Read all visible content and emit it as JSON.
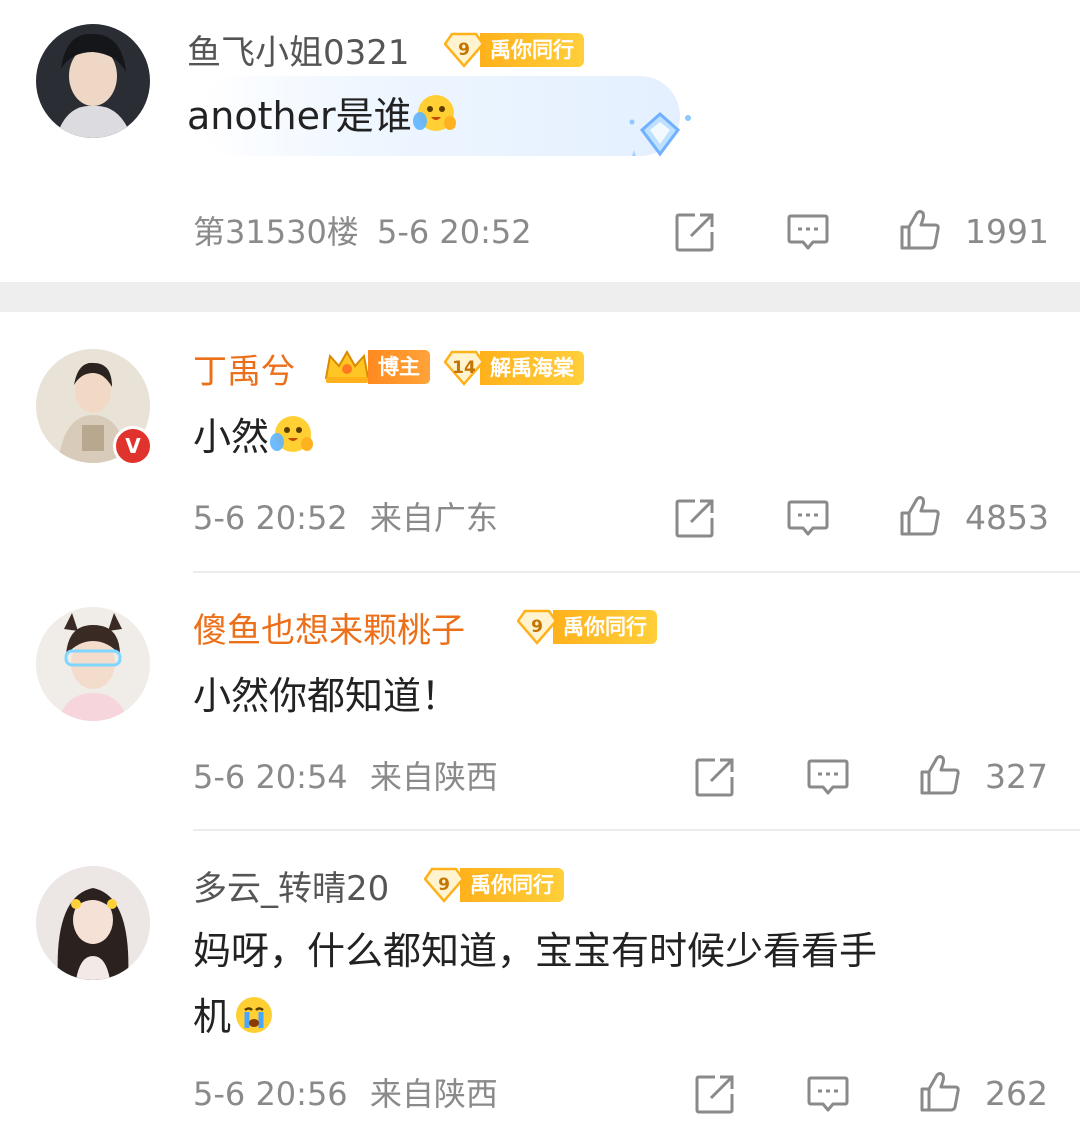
{
  "comments": [
    {
      "username": "鱼飞小姐0321",
      "badge": {
        "level": "9",
        "label": "禹你同行"
      },
      "text": "another是谁",
      "emoji": "hug-emoji",
      "floor": "第31530楼",
      "time": "5-6 20:52",
      "location": "",
      "likes": "1991"
    },
    {
      "username": "丁禹兮",
      "blogger_badge": "博主",
      "badge": {
        "level": "14",
        "label": "解禹海棠"
      },
      "text": "小然",
      "emoji": "hug-emoji",
      "time": "5-6 20:52",
      "location": "来自广东",
      "likes": "4853",
      "verified": "V"
    },
    {
      "username": "傻鱼也想来颗桃子",
      "badge": {
        "level": "9",
        "label": "禹你同行"
      },
      "text": "小然你都知道！",
      "time": "5-6 20:54",
      "location": "来自陕西",
      "likes": "327"
    },
    {
      "username": "多云_转晴20",
      "badge": {
        "level": "9",
        "label": "禹你同行"
      },
      "text_line1": "妈呀，什么都知道，宝宝有时候少看看手",
      "text_line2": "机",
      "emoji": "crying-emoji",
      "time": "5-6 20:56",
      "location": "来自陕西",
      "likes": "262"
    }
  ],
  "icons": {
    "share": "share-icon",
    "comment": "comment-icon",
    "like": "thumbs-up-icon"
  },
  "colors": {
    "orange_name": "#ec6f1a",
    "badge_gold": "#ffb11b",
    "meta_gray": "#8a8a8a",
    "verified_red": "#e0332d"
  }
}
